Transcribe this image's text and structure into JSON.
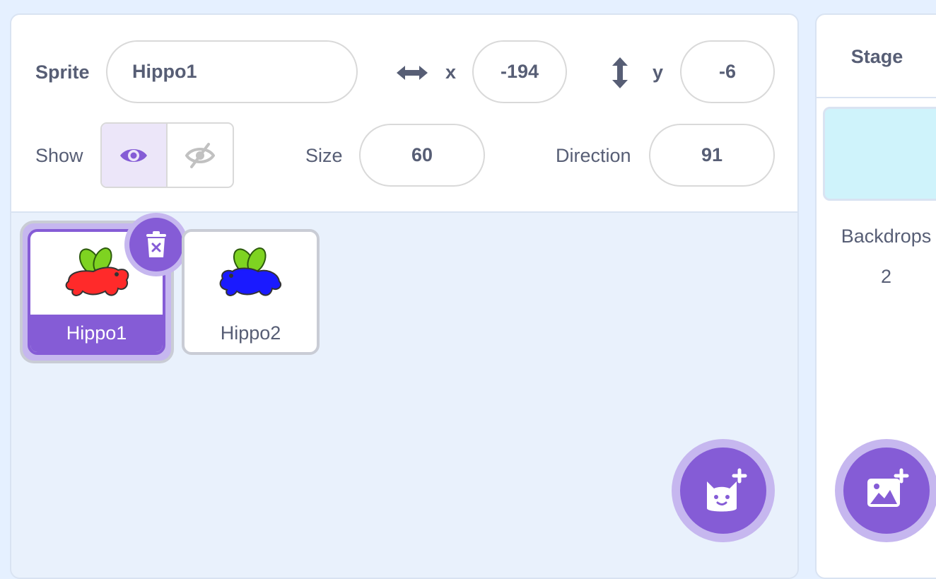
{
  "sprite_info": {
    "sprite_label": "Sprite",
    "sprite_name": "Hippo1",
    "x_label": "x",
    "x_value": "-194",
    "y_label": "y",
    "y_value": "-6",
    "show_label": "Show",
    "show_state": "visible",
    "size_label": "Size",
    "size_value": "60",
    "direction_label": "Direction",
    "direction_value": "91"
  },
  "sprites": [
    {
      "name": "Hippo1",
      "selected": true,
      "color": "#ff2a2a"
    },
    {
      "name": "Hippo2",
      "selected": false,
      "color": "#1a1aff"
    }
  ],
  "stage": {
    "title": "Stage",
    "backdrops_label": "Backdrops",
    "backdrops_count": "2"
  },
  "icons": {
    "x": "horizontal-arrows-icon",
    "y": "vertical-arrows-icon",
    "show": "eye-icon",
    "hide": "eye-slash-icon",
    "delete": "trash-icon",
    "add_sprite": "cat-plus-icon",
    "add_backdrop": "image-plus-icon"
  },
  "colors": {
    "accent": "#855cd6",
    "accent_halo": "#c6b7ef",
    "text": "#575e75",
    "background": "#e5f0ff",
    "stage_backdrop": "#cff3fb"
  }
}
